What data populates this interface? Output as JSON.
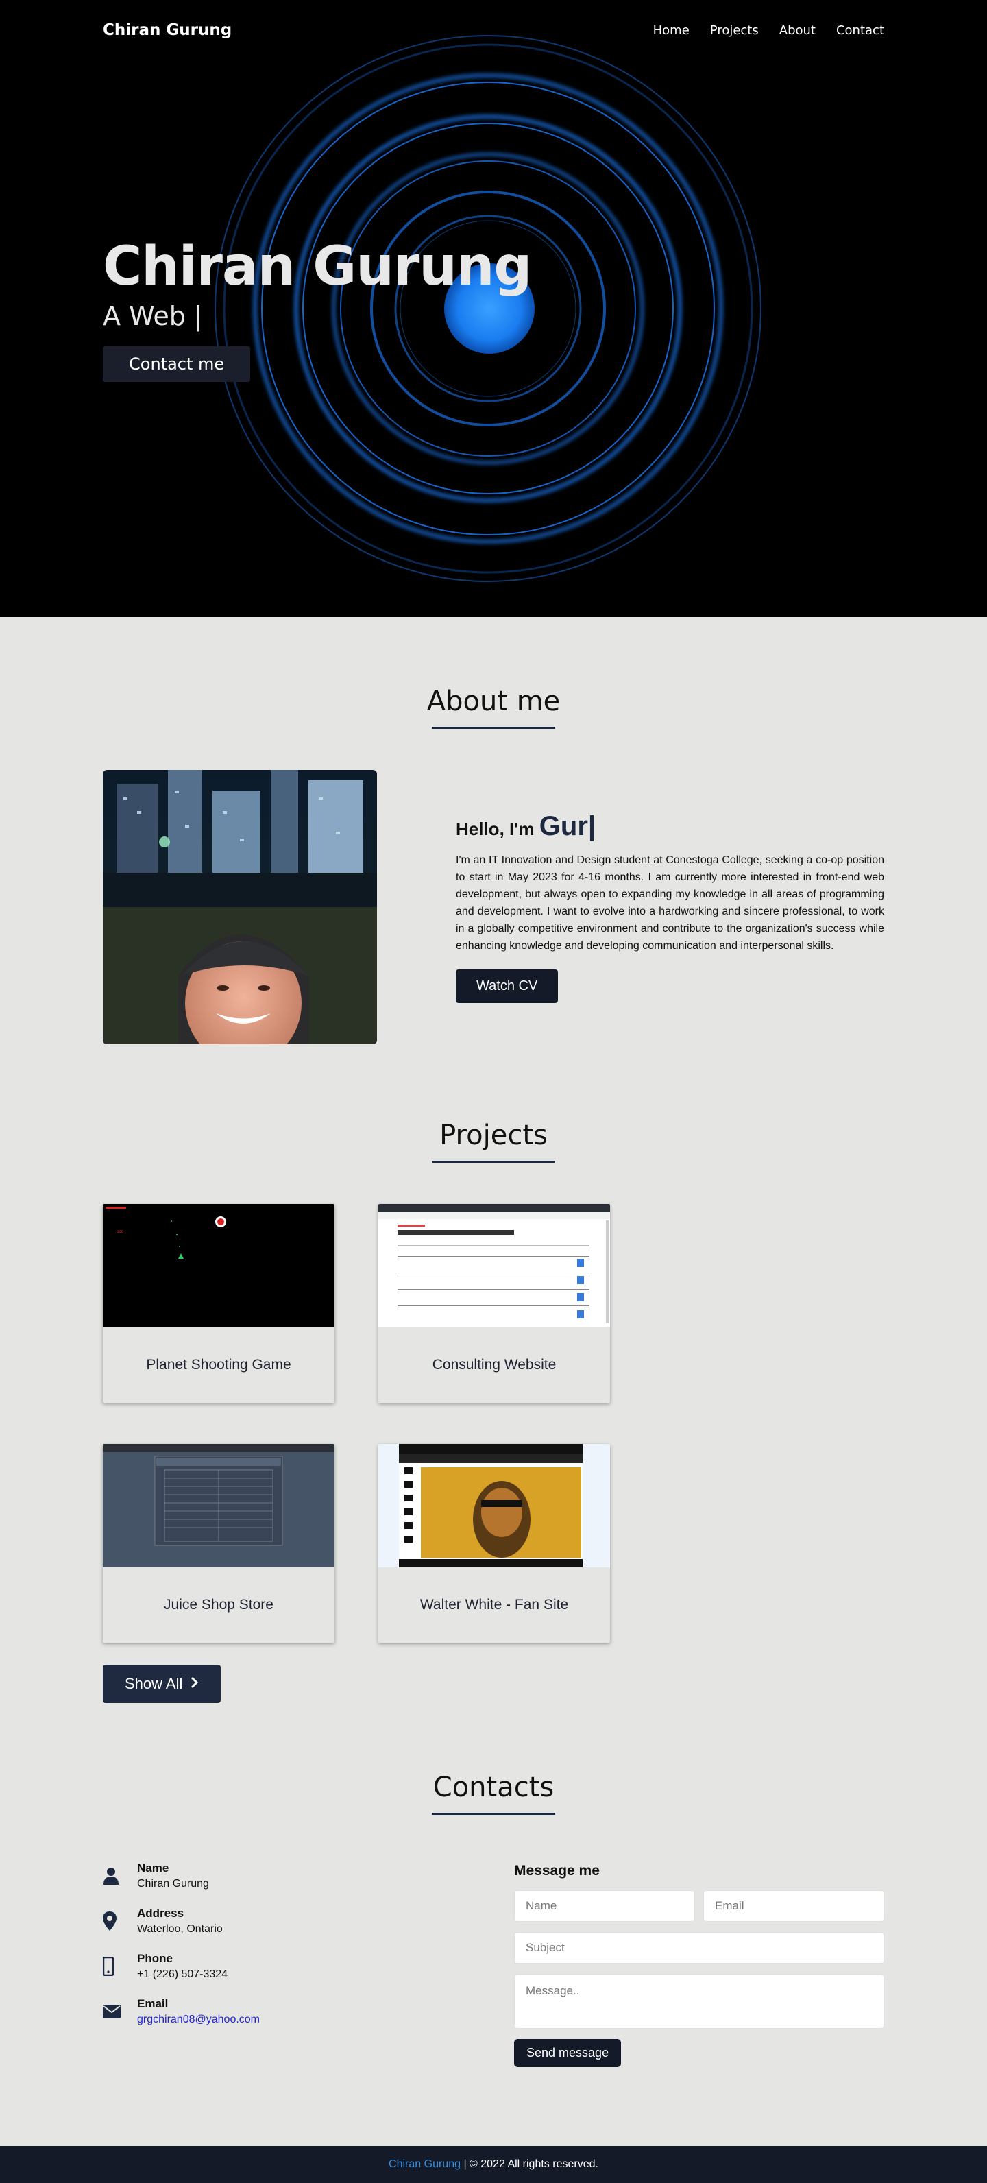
{
  "nav": {
    "brand": "Chiran Gurung",
    "links": [
      "Home",
      "Projects",
      "About",
      "Contact"
    ]
  },
  "hero": {
    "title": "Chiran Gurung",
    "subtitle": "A Web |",
    "button": "Contact me"
  },
  "about": {
    "title": "About me",
    "hello_prefix": "Hello, I'm",
    "hello_typed": "Gur|",
    "paragraph": "I'm an IT Innovation and Design student at Conestoga College, seeking a co-op position to start in May 2023 for 4-16 months. I am currently more interested in front-end web development, but always open to expanding my knowledge in all areas of programming and development. I want to evolve into a hardworking and sincere professional, to work in a globally competitive environment and contribute to the organization's success while enhancing knowledge and developing communication and interpersonal skills.",
    "cv_button": "Watch CV"
  },
  "projects": {
    "title": "Projects",
    "items": [
      {
        "title": "Planet Shooting Game"
      },
      {
        "title": "Consulting Website"
      },
      {
        "title": "Juice Shop Store"
      },
      {
        "title": "Walter White - Fan Site"
      }
    ],
    "show_all": "Show All"
  },
  "contacts": {
    "title": "Contacts",
    "info": [
      {
        "label": "Name",
        "value": "Chiran Gurung",
        "icon": "user-icon"
      },
      {
        "label": "Address",
        "value": "Waterloo, Ontario",
        "icon": "map-pin-icon"
      },
      {
        "label": "Phone",
        "value": "+1 (226) 507-3324",
        "icon": "phone-icon"
      },
      {
        "label": "Email",
        "value": "grgchiran08@yahoo.com",
        "icon": "envelope-icon"
      }
    ],
    "form": {
      "heading": "Message me",
      "name_placeholder": "Name",
      "email_placeholder": "Email",
      "subject_placeholder": "Subject",
      "message_placeholder": "Message..",
      "send": "Send message"
    }
  },
  "footer": {
    "name": "Chiran Gurung",
    "rest": " | © 2022 All rights reserved."
  },
  "colors": {
    "dark": "#141a28",
    "navy": "#1d2940",
    "page_bg": "#e5e6e3",
    "footer_link": "#3d8fdc",
    "ring_blue": "#1a6fe0"
  }
}
